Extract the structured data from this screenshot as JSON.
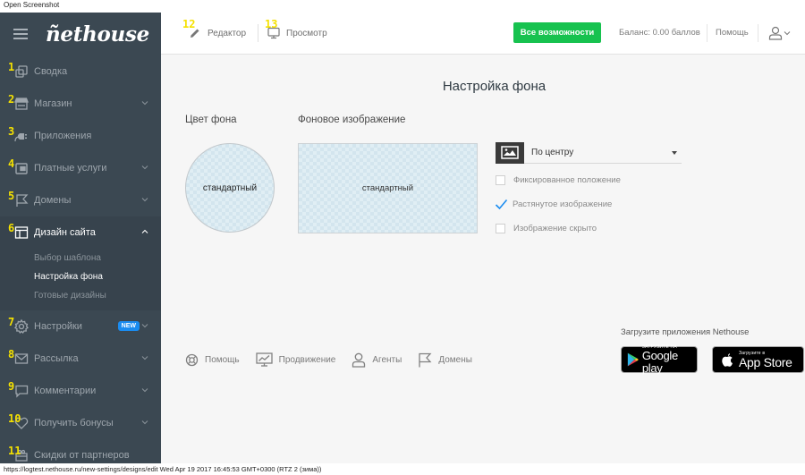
{
  "window": {
    "top_caption": "Open Screenshot",
    "status_line": "https://logtest.nethouse.ru/new-settings/designs/edit Wed Apr 19 2017 16:45:53 GMT+0300 (RTZ 2 (зима))"
  },
  "sidebar": {
    "logo": "ñethouse",
    "items": [
      {
        "num": "1",
        "label": "Сводка",
        "icon": "squares-icon",
        "has_chevron": false
      },
      {
        "num": "2",
        "label": "Магазин",
        "icon": "store-icon",
        "has_chevron": true
      },
      {
        "num": "3",
        "label": "Приложения",
        "icon": "plug-icon",
        "has_chevron": false
      },
      {
        "num": "4",
        "label": "Платные услуги",
        "icon": "wallet-icon",
        "has_chevron": true
      },
      {
        "num": "5",
        "label": "Домены",
        "icon": "flag-icon",
        "has_chevron": true
      },
      {
        "num": "6",
        "label": "Дизайн сайта",
        "icon": "layout-icon",
        "expanded": true,
        "subitems": [
          {
            "label": "Выбор шаблона",
            "active": false
          },
          {
            "label": "Настройка фона",
            "active": true
          },
          {
            "label": "Готовые дизайны",
            "active": false
          }
        ]
      },
      {
        "num": "7",
        "label": "Настройки",
        "icon": "gear-icon",
        "has_chevron": true,
        "badge": "NEW"
      },
      {
        "num": "8",
        "label": "Рассылка",
        "icon": "mail-icon",
        "has_chevron": true
      },
      {
        "num": "9",
        "label": "Комментарии",
        "icon": "comment-icon",
        "has_chevron": true
      },
      {
        "num": "10",
        "label": "Получить бонусы",
        "icon": "heart-icon",
        "has_chevron": true
      },
      {
        "num": "11",
        "label": "Скидки от партнеров",
        "icon": "gift-icon",
        "has_chevron": false
      }
    ]
  },
  "topbar": {
    "tabs": [
      {
        "num": "12",
        "label": "Редактор",
        "icon": "pencil-icon"
      },
      {
        "num": "13",
        "label": "Просмотр",
        "icon": "monitor-icon"
      }
    ],
    "cta_label": "Все возможности",
    "balance": "Баланс: 0.00 баллов",
    "help": "Помощь"
  },
  "main": {
    "title": "Настройка фона",
    "color_label": "Цвет фона",
    "color_value": "стандартный",
    "image_label": "Фоновое изображение",
    "image_value": "стандартный",
    "position_select": {
      "selected": "По центру"
    },
    "options": [
      {
        "label": "Фиксированное положение",
        "checked": false
      },
      {
        "label": "Растянутое изображение",
        "checked": true
      },
      {
        "label": "Изображение скрыто",
        "checked": false
      }
    ],
    "footer_links": [
      {
        "label": "Помощь",
        "icon": "lifebuoy-icon"
      },
      {
        "label": "Продвижение",
        "icon": "chart-monitor-icon"
      },
      {
        "label": "Агенты",
        "icon": "user-icon"
      },
      {
        "label": "Домены",
        "icon": "flag-icon"
      }
    ],
    "apps": {
      "label": "Загрузите приложения Nethouse",
      "google_small": "ЗАГРУЗИТЕ НА",
      "google_big": "Google play",
      "apple_small": "Загрузите в",
      "apple_big": "App Store"
    }
  },
  "colors": {
    "sidebar_bg": "#3b4852",
    "cta_green": "#17c24f",
    "badge_blue": "#1a8cf0",
    "check_blue": "#1a8cf0",
    "annotation_yellow": "#f5e100"
  }
}
